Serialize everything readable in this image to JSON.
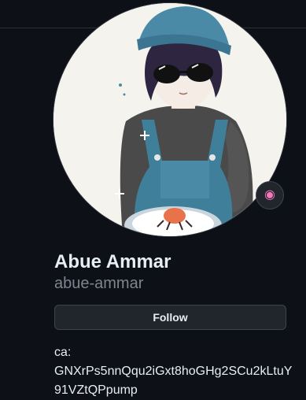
{
  "profile": {
    "display_name": "Abue Ammar",
    "username": "abue-ammar",
    "follow_label": "Follow",
    "avatar_icon": "anime-boy-avatar-icon",
    "status_icon": "status-emoji-icon",
    "status_glyph": "◉",
    "bio": {
      "line1": "ca:",
      "line2": "GNXrPs5nnQqu2iGxt8hoGHg2SCu2kLtuY",
      "line3": "91VZtQPpump"
    }
  },
  "colors": {
    "background": "#0d1117",
    "text_primary": "#e6edf3",
    "text_muted": "#7d8590",
    "button_bg": "#21262d",
    "border": "#3d444d"
  }
}
